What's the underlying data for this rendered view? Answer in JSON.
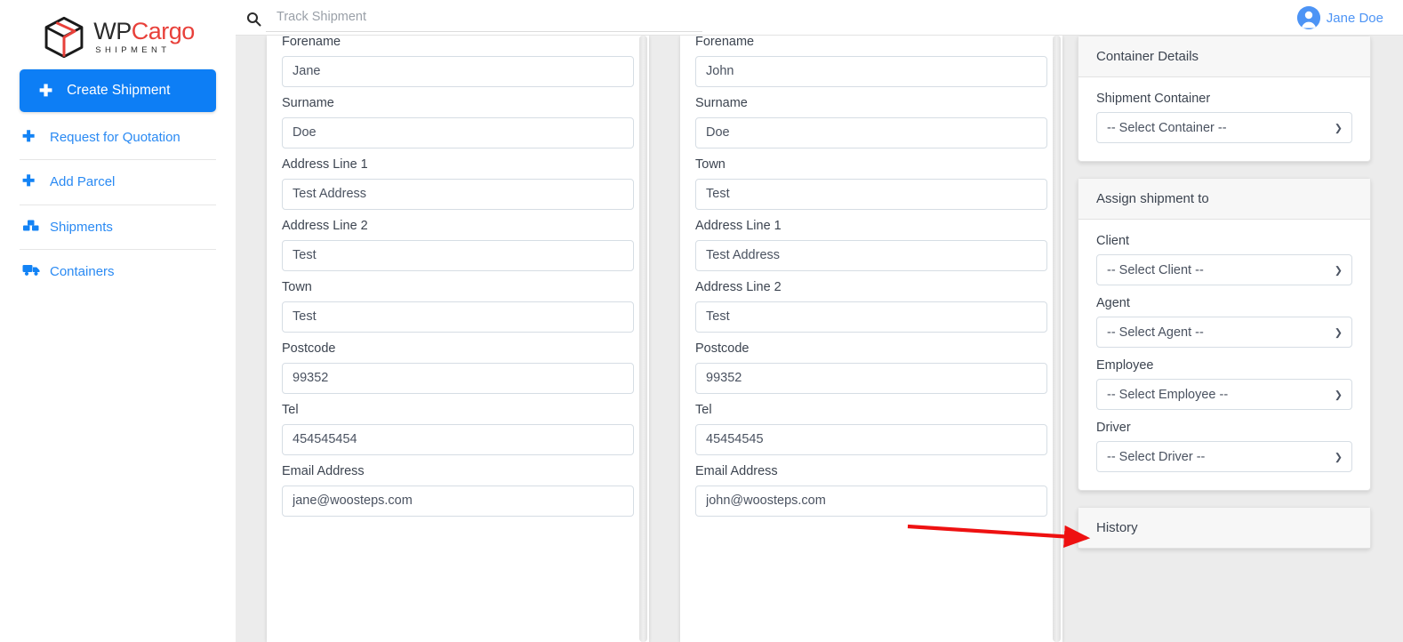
{
  "brand": {
    "name_part1": "WP",
    "name_part2": "Cargo",
    "subtitle": "SHIPMENT",
    "accent_red": "#e8403a",
    "accent_blue": "#0d7ef5"
  },
  "sidebar": {
    "primary": {
      "label": "Create Shipment",
      "icon": "plus-icon"
    },
    "items": [
      {
        "label": "Request for Quotation",
        "icon": "plus-icon"
      },
      {
        "label": "Add Parcel",
        "icon": "plus-icon"
      },
      {
        "label": "Shipments",
        "icon": "boxes-icon"
      },
      {
        "label": "Containers",
        "icon": "truck-icon"
      }
    ]
  },
  "topbar": {
    "search_placeholder": "Track Shipment",
    "search_value": "",
    "search_icon": "search-icon",
    "user_name": "Jane Doe",
    "avatar_icon": "user-avatar-icon"
  },
  "sender_form": {
    "fields": [
      {
        "label": "Forename",
        "value": "Jane"
      },
      {
        "label": "Surname",
        "value": "Doe"
      },
      {
        "label": "Address Line 1",
        "value": "Test Address"
      },
      {
        "label": "Address Line 2",
        "value": "Test"
      },
      {
        "label": "Town",
        "value": "Test"
      },
      {
        "label": "Postcode",
        "value": "99352"
      },
      {
        "label": "Tel",
        "value": "454545454"
      },
      {
        "label": "Email Address",
        "value": "jane@woosteps.com"
      }
    ]
  },
  "receiver_form": {
    "fields": [
      {
        "label": "Forename",
        "value": "John"
      },
      {
        "label": "Surname",
        "value": "Doe"
      },
      {
        "label": "Town",
        "value": "Test"
      },
      {
        "label": "Address Line 1",
        "value": "Test Address"
      },
      {
        "label": "Address Line 2",
        "value": "Test"
      },
      {
        "label": "Postcode",
        "value": "99352"
      },
      {
        "label": "Tel",
        "value": "45454545"
      },
      {
        "label": "Email Address",
        "value": "john@woosteps.com"
      }
    ]
  },
  "container_panel": {
    "title": "Container Details",
    "fields": [
      {
        "label": "Shipment Container",
        "selected": "-- Select Container --"
      }
    ]
  },
  "assign_panel": {
    "title": "Assign shipment to",
    "fields": [
      {
        "label": "Client",
        "selected": "-- Select Client --"
      },
      {
        "label": "Agent",
        "selected": "-- Select Agent --"
      },
      {
        "label": "Employee",
        "selected": "-- Select Employee --"
      },
      {
        "label": "Driver",
        "selected": "-- Select Driver --"
      }
    ]
  },
  "history_panel": {
    "title": "History"
  },
  "annotation": {
    "type": "arrow",
    "color": "#ee1111",
    "points_to": "Driver select dropdown"
  }
}
